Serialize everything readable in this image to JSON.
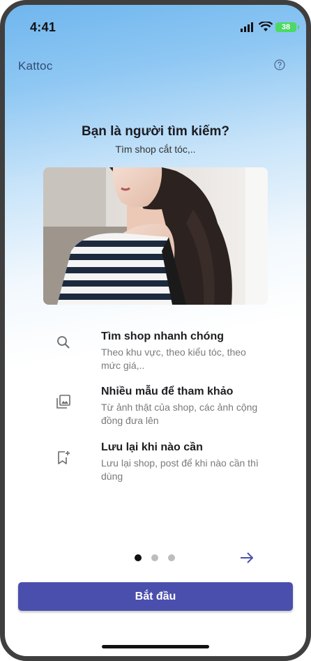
{
  "status_bar": {
    "time": "4:41",
    "battery": "38"
  },
  "header": {
    "brand": "Kattoc",
    "help_icon": "help-circle-icon"
  },
  "hero": {
    "title": "Bạn là người tìm kiếm?",
    "subtitle": "Tìm shop cắt tóc,.."
  },
  "features": [
    {
      "icon": "search-icon",
      "title": "Tìm shop nhanh chóng",
      "description": "Theo khu vực, theo kiểu tóc, theo mức giá,.."
    },
    {
      "icon": "gallery-icon",
      "title": "Nhiều mẫu để tham khảo",
      "description": "Từ ảnh thật của shop, các ảnh cộng đồng đưa lên"
    },
    {
      "icon": "bookmark-add-icon",
      "title": "Lưu lại khi nào cần",
      "description": "Lưu lại shop, post để khi nào cần thì dùng"
    }
  ],
  "pager": {
    "total": 3,
    "active": 1
  },
  "cta": {
    "label": "Bắt đầu"
  },
  "colors": {
    "primary": "#4a4fad",
    "brand_text": "#2f4d73",
    "sky": "#6fb6ee"
  }
}
